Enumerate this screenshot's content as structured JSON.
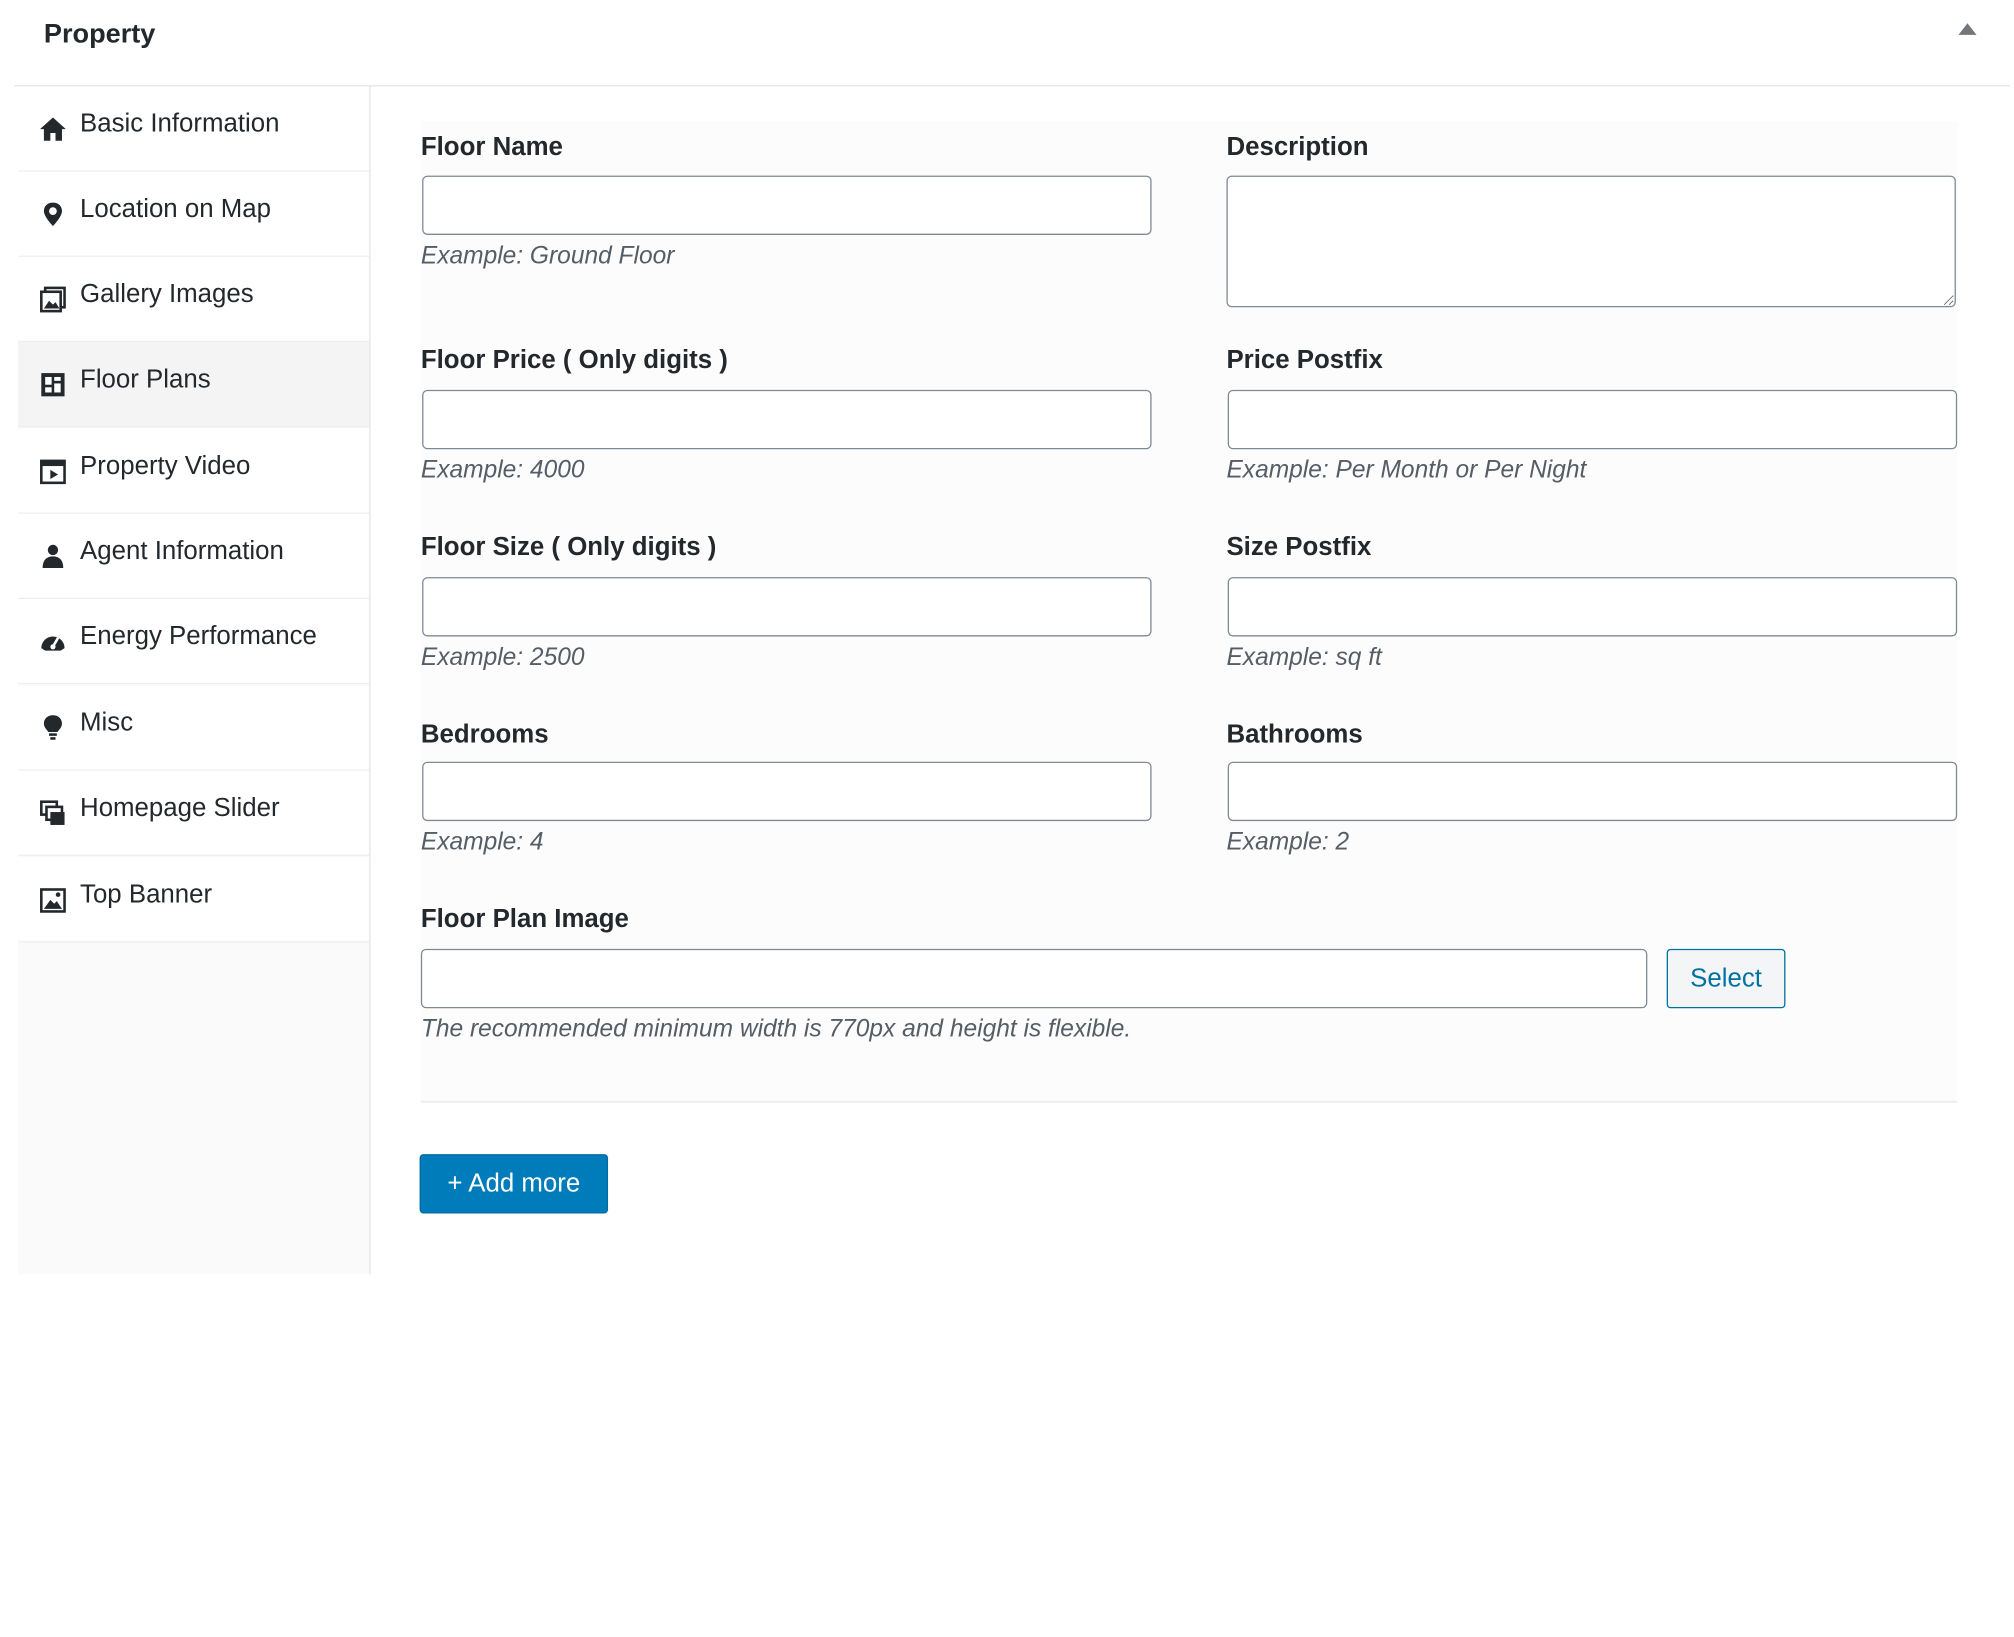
{
  "metabox": {
    "title": "Property"
  },
  "sidebar": {
    "items": [
      {
        "label": "Basic Information",
        "icon": "home-icon"
      },
      {
        "label": "Location on Map",
        "icon": "location-pin-icon"
      },
      {
        "label": "Gallery Images",
        "icon": "gallery-icon"
      },
      {
        "label": "Floor Plans",
        "icon": "floor-plan-icon",
        "active": true
      },
      {
        "label": "Property Video",
        "icon": "video-icon"
      },
      {
        "label": "Agent Information",
        "icon": "agent-icon"
      },
      {
        "label": "Energy Performance",
        "icon": "gauge-icon"
      },
      {
        "label": "Misc",
        "icon": "lightbulb-icon"
      },
      {
        "label": "Homepage Slider",
        "icon": "slider-icon"
      },
      {
        "label": "Top Banner",
        "icon": "banner-image-icon"
      }
    ]
  },
  "form": {
    "floor_name": {
      "label": "Floor Name",
      "value": "",
      "hint": "Example: Ground Floor"
    },
    "description": {
      "label": "Description",
      "value": ""
    },
    "floor_price": {
      "label": "Floor Price ( Only digits )",
      "value": "",
      "hint": "Example: 4000"
    },
    "price_postfix": {
      "label": "Price Postfix",
      "value": "",
      "hint": "Example: Per Month or Per Night"
    },
    "floor_size": {
      "label": "Floor Size ( Only digits )",
      "value": "",
      "hint": "Example: 2500"
    },
    "size_postfix": {
      "label": "Size Postfix",
      "value": "",
      "hint": "Example: sq ft"
    },
    "bedrooms": {
      "label": "Bedrooms",
      "value": "",
      "hint": "Example: 4"
    },
    "bathrooms": {
      "label": "Bathrooms",
      "value": "",
      "hint": "Example: 2"
    },
    "floor_plan_image": {
      "label": "Floor Plan Image",
      "value": "",
      "select_label": "Select",
      "hint": "The recommended minimum width is 770px and height is flexible."
    }
  },
  "actions": {
    "add_more_label": "+ Add more"
  },
  "colors": {
    "accent": "#007cba",
    "link": "#0071a1"
  }
}
